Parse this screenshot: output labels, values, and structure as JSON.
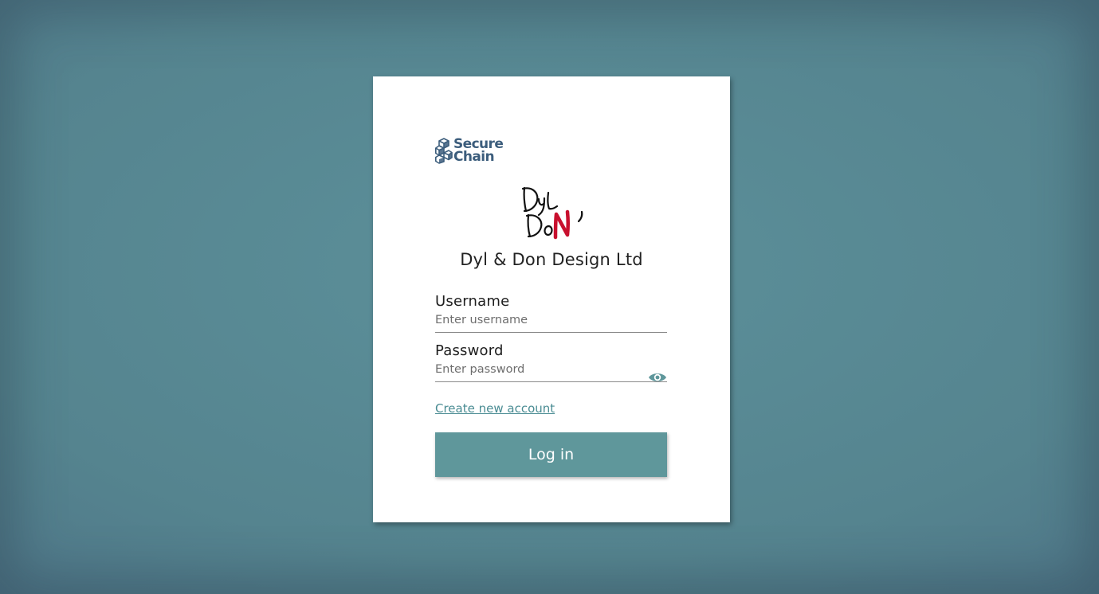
{
  "brand": {
    "name_line1": "Secure",
    "name_line2": "Chain",
    "icon": "cube-cluster-icon",
    "color": "#3c5d7c"
  },
  "company": {
    "logo_icon": "dyl-don-handwritten-logo",
    "logo_accent_color": "#c8102e",
    "name": "Dyl & Don Design Ltd"
  },
  "form": {
    "username": {
      "label": "Username",
      "placeholder": "Enter username",
      "value": ""
    },
    "password": {
      "label": "Password",
      "placeholder": "Enter password",
      "value": "",
      "toggle_icon": "eye-icon"
    },
    "create_account_link": "Create new account",
    "login_button": "Log in"
  },
  "colors": {
    "accent": "#5f979b",
    "link": "#4a8c93"
  }
}
